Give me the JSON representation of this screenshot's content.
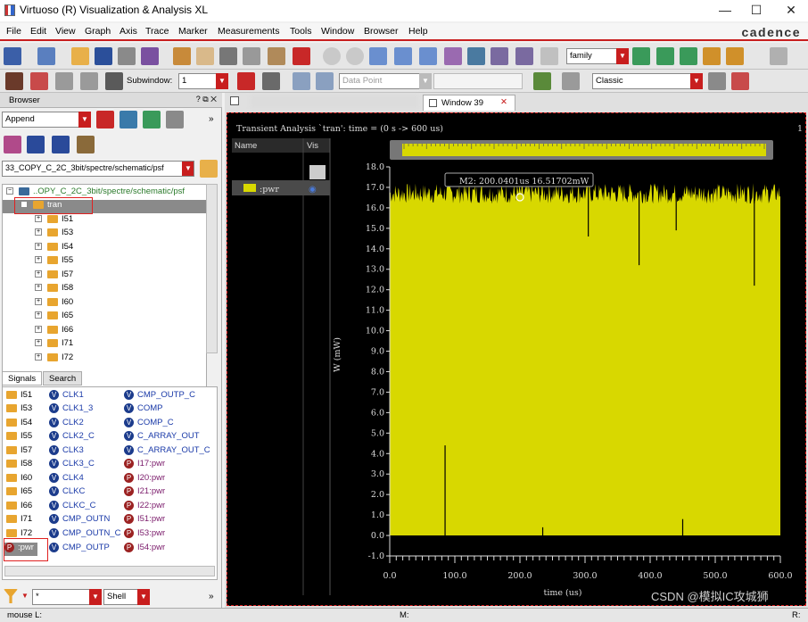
{
  "app": {
    "title": "Virtuoso (R) Visualization & Analysis XL",
    "brand": "cadence",
    "window_controls": [
      "—",
      "☐",
      "✕"
    ]
  },
  "menu": [
    "File",
    "Edit",
    "View",
    "Graph",
    "Axis",
    "Trace",
    "Marker",
    "Measurements",
    "Tools",
    "Window",
    "Browser",
    "Help"
  ],
  "toolbar": {
    "family_combo": "family",
    "subwindow_label": "Subwindow:",
    "subwindow_value": "1",
    "data_point_placeholder": "Data Point",
    "classic_combo": "Classic"
  },
  "browser": {
    "title": "Browser",
    "append_combo": "Append",
    "path_value": "33_COPY_C_2C_3bit/spectre/schematic/psf",
    "tree_root": "..OPY_C_2C_3bit/spectre/schematic/psf",
    "tree_selected": "tran",
    "tree_children": [
      "I51",
      "I53",
      "I54",
      "I55",
      "I57",
      "I58",
      "I60",
      "I65",
      "I66",
      "I71",
      "I72"
    ],
    "tabs": [
      "Signals",
      "Search"
    ],
    "signals": {
      "col1": [
        "I51",
        "I53",
        "I54",
        "I55",
        "I57",
        "I58",
        "I60",
        "I65",
        "I66",
        "I71",
        "I72",
        ":pwr"
      ],
      "col2": [
        "CLK1",
        "CLK1_3",
        "CLK2",
        "CLK2_C",
        "CLK3",
        "CLK3_C",
        "CLK4",
        "CLKC",
        "CLKC_C",
        "CMP_OUTN",
        "CMP_OUTN_C",
        "CMP_OUTP"
      ],
      "col3": [
        "CMP_OUTP_C",
        "COMP",
        "COMP_C",
        "C_ARRAY_OUT",
        "C_ARRAY_OUT_C",
        "I17:pwr",
        "I20:pwr",
        "I21:pwr",
        "I22:pwr",
        "I51:pwr",
        "I53:pwr",
        "I54:pwr"
      ]
    },
    "filter_value": "*",
    "shell_combo": "Shell"
  },
  "window_tab": "Window 39",
  "plot": {
    "header": "Transient Analysis `tran': time = (0 s -> 600 us)",
    "page_number": "1",
    "legend_headers": [
      "Name",
      "Vis"
    ],
    "trace_name": ":pwr",
    "marker_label": "M2: 200.0401us 16.51702mW"
  },
  "status": {
    "left": "mouse L:",
    "mid": "M:",
    "right": "R:",
    "watermark": "CSDN @模拟IC攻城狮"
  },
  "colors": {
    "trace": "#d8d800",
    "accent": "#c81e1e",
    "plot_bg": "#000000",
    "link": "#1a3aa8"
  },
  "chart_data": {
    "type": "area",
    "title": "Transient Analysis `tran': time = (0 s -> 600 us)",
    "xlabel": "time (us)",
    "ylabel": "W (mW)",
    "xlim": [
      0,
      600
    ],
    "ylim": [
      -1.0,
      18.0
    ],
    "x_ticks": [
      "0.0",
      "100.0",
      "200.0",
      "300.0",
      "400.0",
      "500.0",
      "600.0"
    ],
    "y_ticks": [
      "18.0",
      "17.0",
      "16.0",
      "15.0",
      "14.0",
      "13.0",
      "12.0",
      "11.0",
      "10.0",
      "9.0",
      "8.0",
      "7.0",
      "6.0",
      "5.0",
      "4.0",
      "3.0",
      "2.0",
      "1.0",
      "0.0",
      "-1.0"
    ],
    "series": [
      {
        "name": ":pwr",
        "baseline": 0.0,
        "typical_peak_range": [
          16.2,
          17.2
        ],
        "deep_dips": [
          {
            "x": 305,
            "y": 14.6
          },
          {
            "x": 383,
            "y": 13.2
          },
          {
            "x": 440,
            "y": 14.9
          },
          {
            "x": 560,
            "y": 12.2
          }
        ],
        "isolated_spikes": [
          {
            "x": 85,
            "y": 4.4
          },
          {
            "x": 235,
            "y": 0.4
          },
          {
            "x": 450,
            "y": 0.8
          }
        ]
      }
    ],
    "marker": {
      "name": "M2",
      "x": 200.0401,
      "y": 16.51702
    }
  }
}
